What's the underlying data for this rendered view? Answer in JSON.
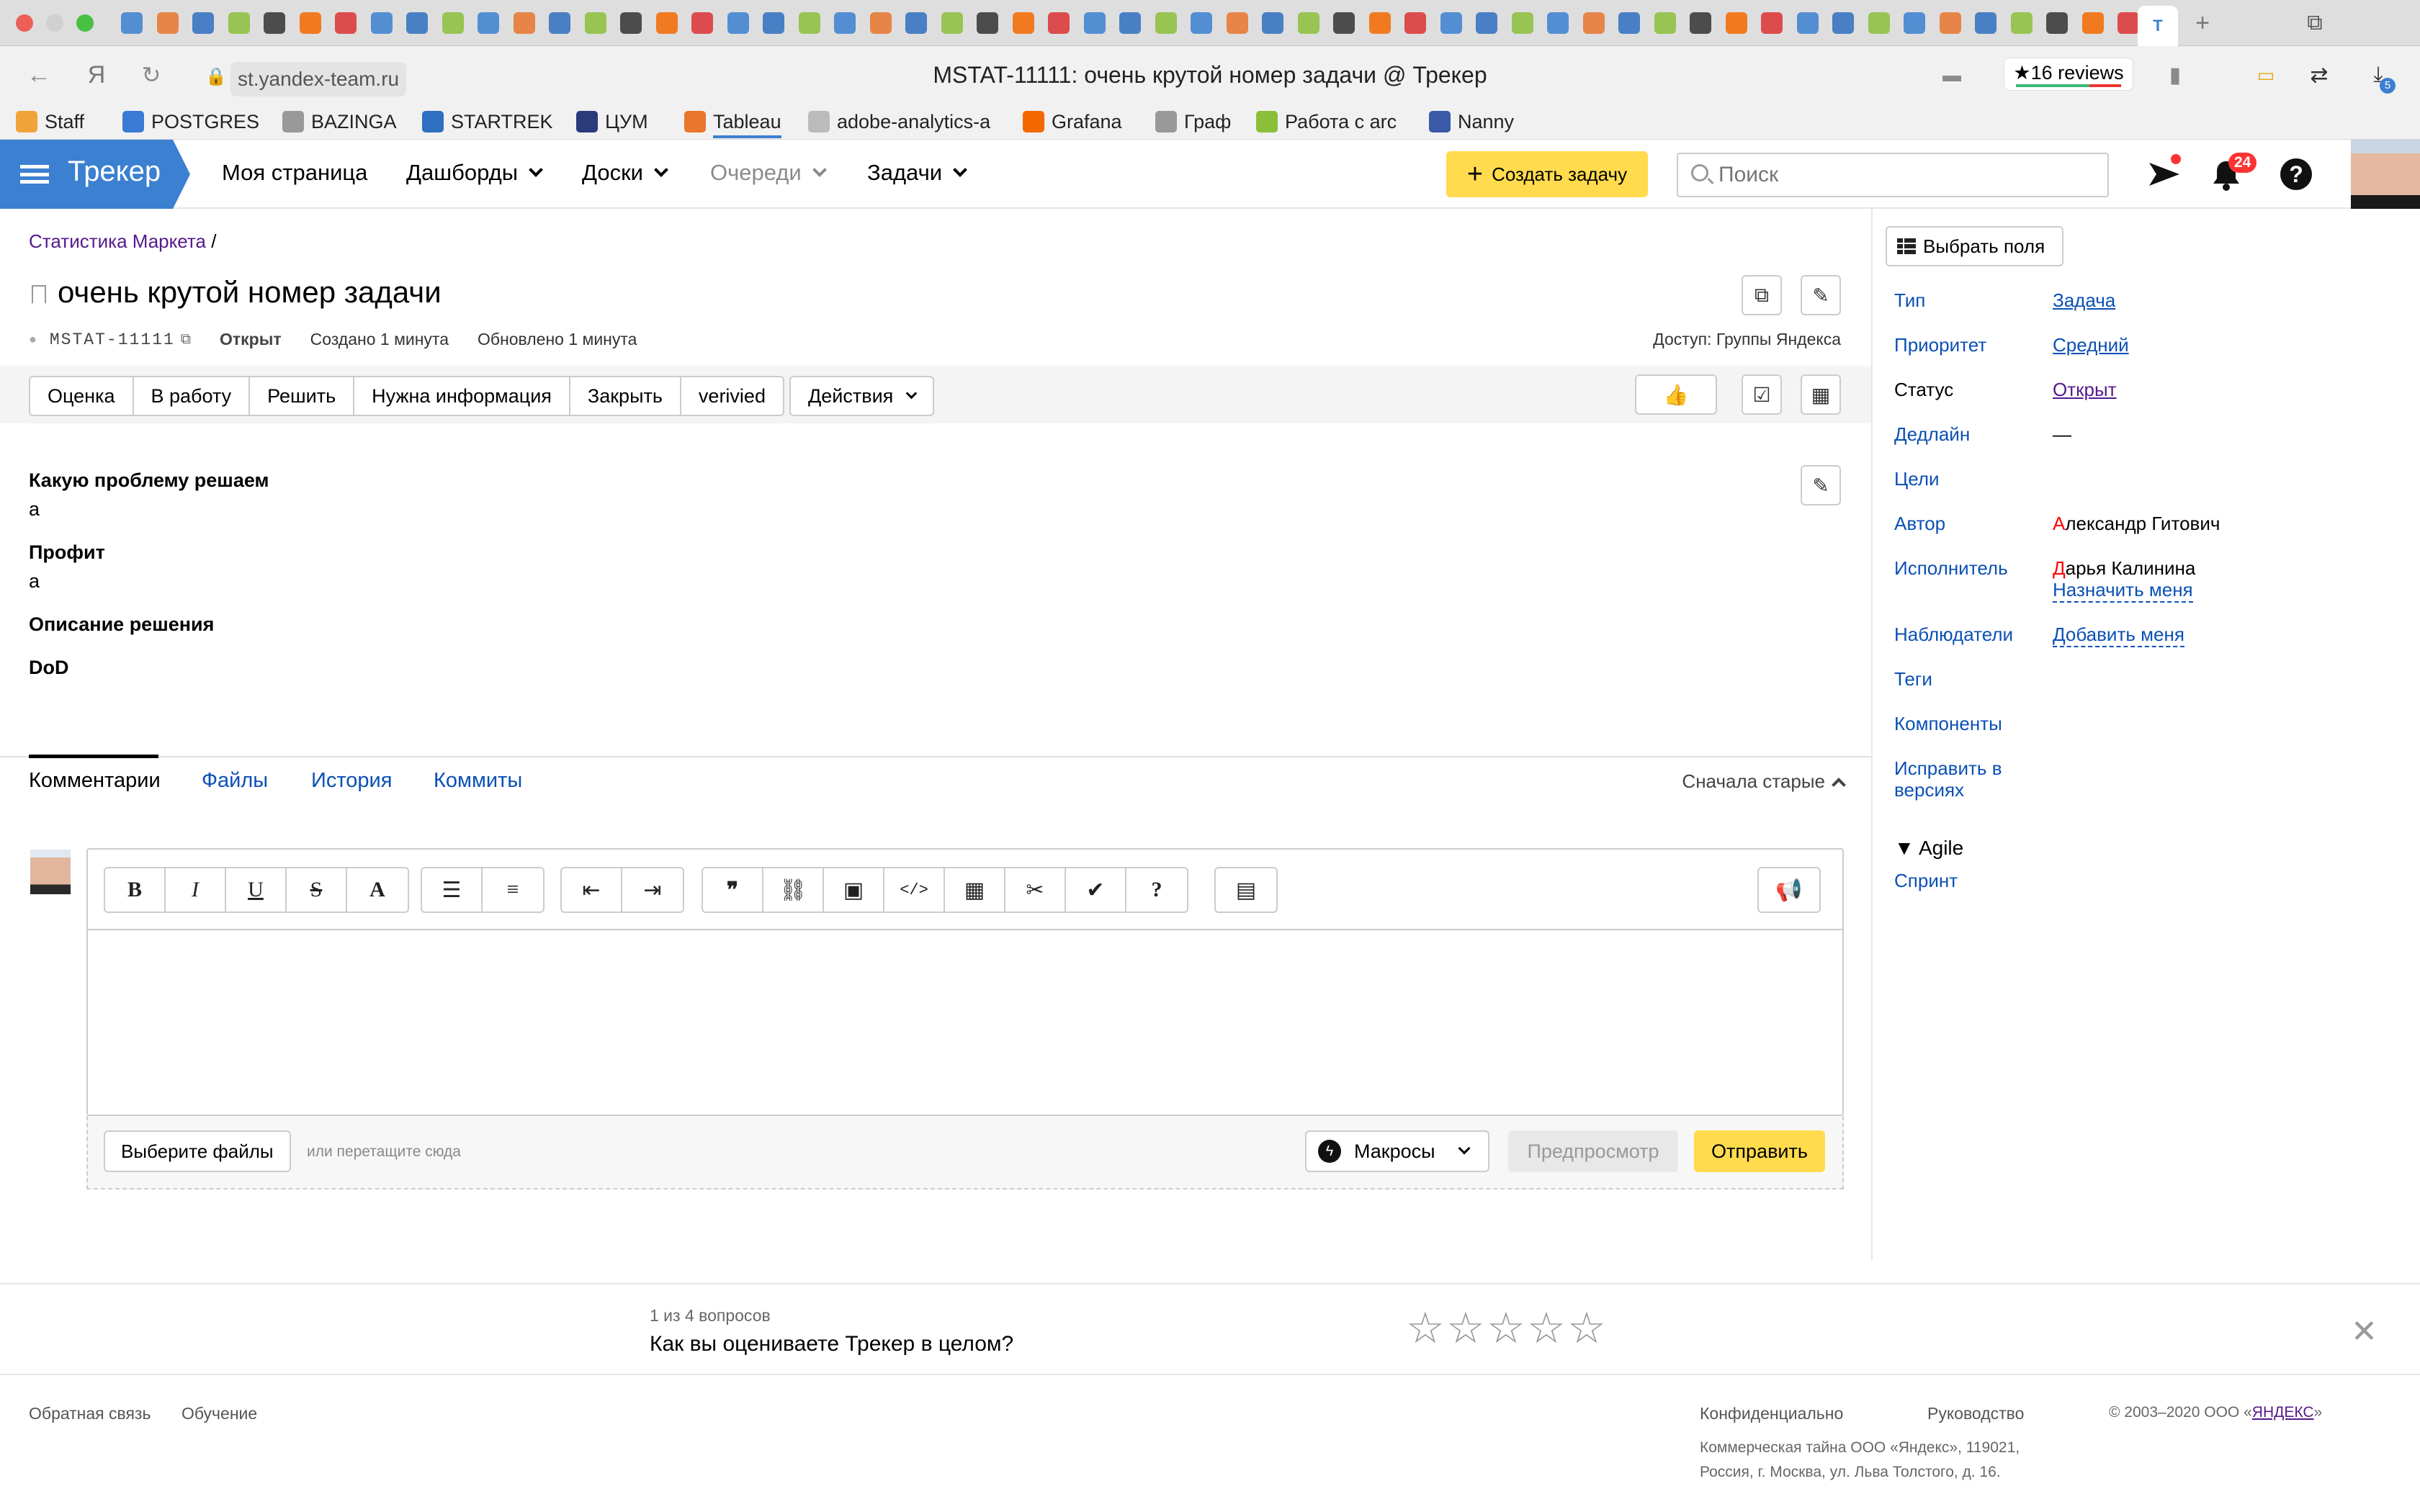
{
  "browser": {
    "url": "st.yandex-team.ru",
    "page_title": "MSTAT-11111: очень крутой номер задачи @ Трекер",
    "reviews": "★16 reviews",
    "downloads_badge": "5",
    "bookmarks": [
      {
        "label": "Staff",
        "icon": "staff-icon",
        "color": "#f0a33b"
      },
      {
        "label": "POSTGRES",
        "icon": "yc-icon",
        "color": "#3a7bd5"
      },
      {
        "label": "BAZINGA",
        "icon": "doc-icon",
        "color": "#999999"
      },
      {
        "label": "STARTREK",
        "icon": "tracker-t-icon",
        "color": "#2f6fbf"
      },
      {
        "label": "ЦУМ",
        "icon": "cart-icon",
        "color": "#2b3a7a"
      },
      {
        "label": "Tableau",
        "icon": "tableau-icon",
        "color": "#e8762d"
      },
      {
        "label": "adobe-analytics-a",
        "icon": "doc-icon",
        "color": "#bbbbbb"
      },
      {
        "label": "Grafana",
        "icon": "grafana-icon",
        "color": "#f46800"
      },
      {
        "label": "Граф",
        "icon": "compass-icon",
        "color": "#999999"
      },
      {
        "label": "Работа с arc",
        "icon": "wiki-w-icon",
        "color": "#8bbf3a"
      },
      {
        "label": "Nanny",
        "icon": "nanny-icon",
        "color": "#3a5aa8"
      }
    ]
  },
  "header": {
    "logo": "Трекер",
    "nav": [
      "Моя страница",
      "Дашборды",
      "Доски",
      "Очереди",
      "Задачи"
    ],
    "create_button": "Создать задачу",
    "search_placeholder": "Поиск",
    "notifications_count": "24"
  },
  "issue": {
    "breadcrumb": "Статистика Маркета",
    "breadcrumb_sep": "/",
    "title": "очень крутой номер задачи",
    "key": "MSTAT-11111",
    "status": "Открыт",
    "created": "Создано 1 минута",
    "updated": "Обновлено 1 минута",
    "access": "Доступ: Группы Яндекса",
    "actions": [
      "Оценка",
      "В работу",
      "Решить",
      "Нужна информация",
      "Закрыть",
      "verivied"
    ],
    "actions_dropdown": "Действия",
    "description": [
      {
        "label": "Какую проблему решаем",
        "value": "a"
      },
      {
        "label": "Профит",
        "value": "a"
      },
      {
        "label": "Описание решения",
        "value": ""
      },
      {
        "label": "DoD",
        "value": ""
      }
    ]
  },
  "comments": {
    "tabs": [
      "Комментарии",
      "Файлы",
      "История",
      "Коммиты"
    ],
    "sort": "Сначала старые",
    "choose_files": "Выберите файлы",
    "drop_hint": "или перетащите сюда",
    "macros": "Макросы",
    "preview": "Предпросмотр",
    "send": "Отправить"
  },
  "sidebar": {
    "choose_fields": "Выбрать поля",
    "fields": [
      {
        "label": "Тип",
        "value": "Задача"
      },
      {
        "label": "Приоритет",
        "value": "Средний"
      },
      {
        "label": "Статус",
        "value": "Открыт"
      },
      {
        "label": "Дедлайн",
        "value": "—"
      },
      {
        "label": "Цели",
        "value": ""
      },
      {
        "label": "Автор",
        "value_initial": "А",
        "value_rest": "лександр Гитович"
      },
      {
        "label": "Исполнитель",
        "value_initial": "Д",
        "value_rest": "арья Калинина",
        "extra": "Назначить меня"
      },
      {
        "label": "Наблюдатели",
        "value": "Добавить меня"
      },
      {
        "label": "Теги",
        "value": ""
      },
      {
        "label": "Компоненты",
        "value": ""
      },
      {
        "label": "Исправить в версиях",
        "value": ""
      }
    ],
    "agile_section": "▼ Agile",
    "sprint": "Спринт"
  },
  "feedback": {
    "count": "1 из 4 вопросов",
    "question": "Как вы оцениваете Трекер в целом?",
    "stars": 5
  },
  "footer": {
    "feedback_link": "Обратная связь",
    "learning_link": "Обучение",
    "confidential": "Конфиденциально",
    "guide": "Руководство",
    "copyright_prefix": "© 2003–2020  ООО «",
    "copyright_brand": "ЯНДЕКС",
    "copyright_suffix": "»",
    "legal_line1": "Коммерческая тайна ООО «Яндекс», 119021,",
    "legal_line2": "Россия, г. Москва, ул. Льва Толстого, д. 16."
  },
  "colors": {
    "tracker_blue": "#3b80d1",
    "accent_yellow": "#ffdb4d",
    "link_blue": "#0b50b5",
    "visited_purple": "#551a8b"
  }
}
